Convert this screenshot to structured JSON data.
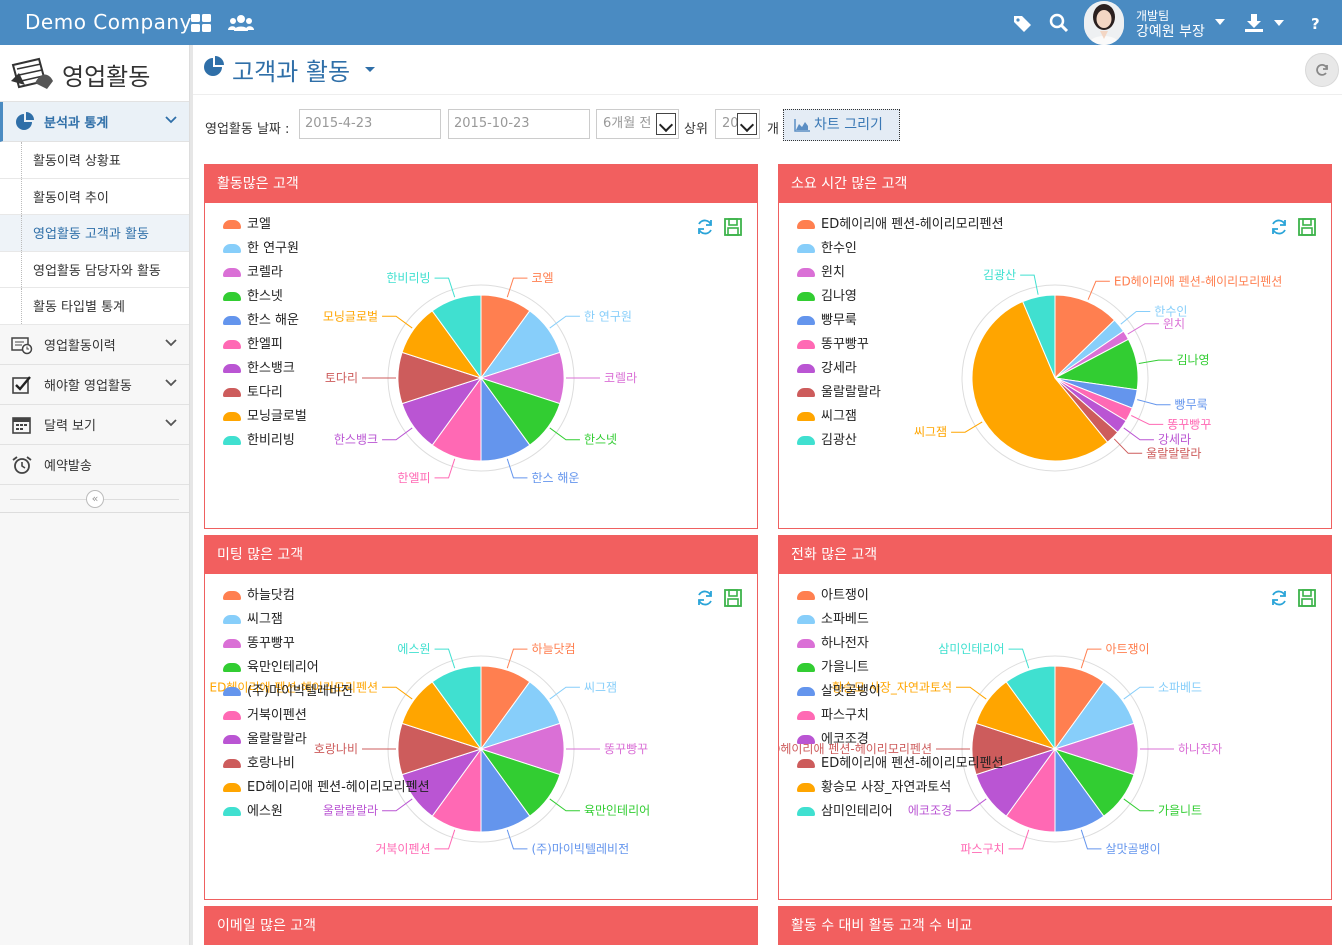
{
  "app": {
    "brand": "Demo Company",
    "user_team": "개발팀",
    "user_name": "강예원 부장"
  },
  "sidebar": {
    "title": "영업활동",
    "sections": [
      {
        "label": "분석과 통계",
        "active": true
      },
      {
        "label": "영업활동이력"
      },
      {
        "label": "해야할 영업활동"
      },
      {
        "label": "달력 보기"
      },
      {
        "label": "예약발송"
      }
    ],
    "subitems": [
      {
        "label": "활동이력 상황표"
      },
      {
        "label": "활동이력 추이"
      },
      {
        "label": "영업활동 고객과 활동",
        "active": true
      },
      {
        "label": "영업활동 담당자와 활동"
      },
      {
        "label": "활동 타입별 통계"
      }
    ]
  },
  "page": {
    "title": "고객과 활동"
  },
  "filters": {
    "date_label": "영업활동 날짜 :",
    "start_date": "2015-4-23",
    "end_date": "2015-10-23",
    "period": "6개월 전",
    "top_label": "상위",
    "top_count": "20",
    "unit": "개",
    "draw_button": "차트 그리기"
  },
  "colors": {
    "topbar": "#4a8bc2",
    "panel_header": "#f25f5f",
    "accent": "#2f6fa8",
    "palette": [
      "#ff7f50",
      "#87cefa",
      "#da70d6",
      "#32cd32",
      "#6495ed",
      "#ff69b4",
      "#ba55d3",
      "#cd5c5c",
      "#ffa500",
      "#40e0d0"
    ]
  },
  "chart_data": [
    {
      "type": "pie",
      "title": "활동많은 고객",
      "categories": [
        "코엘",
        "한 연구원",
        "코렐라",
        "한스넷",
        "한스 해운",
        "한엘피",
        "한스뱅크",
        "토다리",
        "모닝글로벌",
        "한비리빙"
      ],
      "values": [
        1,
        1,
        1,
        1,
        1,
        1,
        1,
        1,
        1,
        1
      ]
    },
    {
      "type": "pie",
      "title": "소요 시간 많은 고객",
      "categories": [
        "ED헤이리애 펜션-헤이리모리펜션",
        "한수인",
        "윈치",
        "김나영",
        "빵무룩",
        "똥꾸빵꾸",
        "강세라",
        "울랄랄랄라",
        "씨그잼",
        "김광산"
      ],
      "values": [
        14,
        3,
        2,
        11,
        4,
        3,
        3,
        3,
        60,
        7
      ]
    },
    {
      "type": "pie",
      "title": "미팅 많은 고객",
      "categories": [
        "하늘닷컴",
        "씨그잼",
        "똥꾸빵꾸",
        "육만인테리어",
        "(주)마이빅텔레비전",
        "거북이펜션",
        "울랄랄랄라",
        "호랑나비",
        "ED헤이리애 펜션-헤이리모리펜션",
        "에스원"
      ],
      "values": [
        1,
        1,
        1,
        1,
        1,
        1,
        1,
        1,
        1,
        1
      ]
    },
    {
      "type": "pie",
      "title": "전화 많은 고객",
      "categories": [
        "아트쟁이",
        "소파베드",
        "하나전자",
        "가을니트",
        "살맛골뱅이",
        "파스구치",
        "에코조경",
        "ED헤이리애 펜션-헤이리모리펜션",
        "황승모 사장_자연과토석",
        "삼미인테리어"
      ],
      "values": [
        1,
        1,
        1,
        1,
        1,
        1,
        1,
        1,
        1,
        1
      ]
    }
  ],
  "bottom_panels": {
    "left_title": "이메일 많은 고객",
    "right_title": "활동 수 대비 활동 고객 수 비교"
  }
}
